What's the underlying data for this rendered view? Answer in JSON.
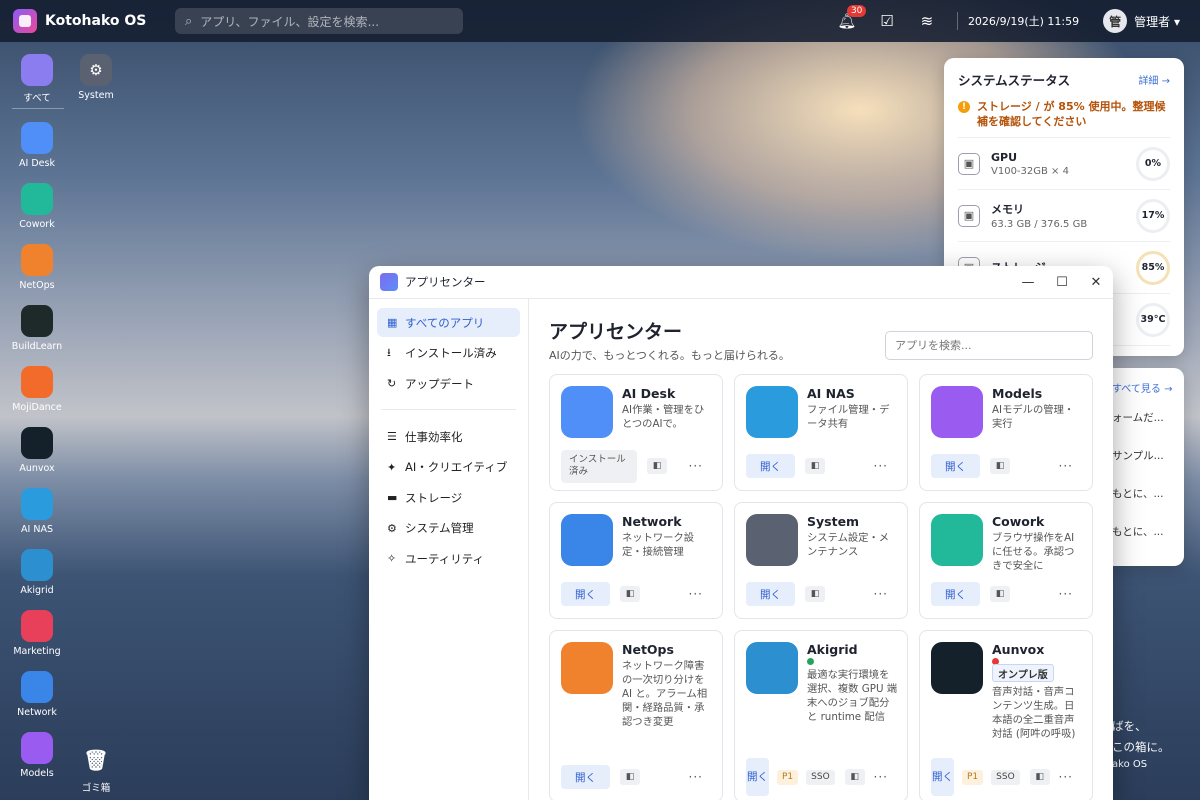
{
  "topbar": {
    "brand": "Kotohako OS",
    "search_placeholder": "アプリ、ファイル、設定を検索...",
    "notification_count": "30",
    "datetime": "2026/9/19(土) 11:59",
    "user_initial": "管",
    "user_name": "管理者"
  },
  "dock": [
    {
      "label": "すべて",
      "color": "#8b7cf0",
      "icon": "grid-icon"
    },
    {
      "label": "AI Desk",
      "color": "#4f8ff7",
      "icon": "chat-sparkle-icon"
    },
    {
      "label": "Cowork",
      "color": "#22b89a",
      "icon": "browser-cursor-icon"
    },
    {
      "label": "NetOps",
      "color": "#f0822e",
      "icon": "network-nodes-icon"
    },
    {
      "label": "BuildLearn",
      "color": "#1e2a2a",
      "icon": "terminal-chat-icon"
    },
    {
      "label": "MojiDance",
      "color": "#f26b2a",
      "icon": "dance-icon"
    },
    {
      "label": "Aunvox",
      "color": "#14202a",
      "icon": "wave-icon"
    },
    {
      "label": "AI NAS",
      "color": "#2a9bdc",
      "icon": "server-icon"
    },
    {
      "label": "Akigrid",
      "color": "#2b8fd0",
      "icon": "grid-chip-icon"
    },
    {
      "label": "Marketing",
      "color": "#e8405b",
      "icon": "megaphone-icon"
    },
    {
      "label": "Network",
      "color": "#3a86e8",
      "icon": "wifi-icon"
    },
    {
      "label": "Models",
      "color": "#9a5cf0",
      "icon": "chip-icon"
    }
  ],
  "desktop": {
    "system_label": "System",
    "trash_label": "ゴミ箱"
  },
  "status_panel": {
    "title": "システムステータス",
    "detail_link": "詳細 →",
    "warning": "ストレージ / が 85% 使用中。整理候補を確認してください",
    "resources": [
      {
        "name": "GPU",
        "sub": "V100-32GB × 4",
        "value": "0%",
        "icon": "cpu-icon"
      },
      {
        "name": "メモリ",
        "sub": "63.3 GB / 376.5 GB",
        "value": "17%",
        "icon": "memory-icon"
      },
      {
        "name": "ストレージ",
        "sub": "",
        "value": "85%",
        "icon": "storage-icon"
      },
      {
        "name": "",
        "sub": "",
        "value": "39°C",
        "icon": "temperature-icon"
      }
    ]
  },
  "panel2": {
    "link": "すべて見る →",
    "items": [
      "ォームだ...",
      "サンプル...",
      "もとに、...",
      "もとに、..."
    ]
  },
  "wallpaper_text": [
    "ばを、",
    "この箱に。",
    "ako OS"
  ],
  "window": {
    "title": "アプリセンター",
    "controls": {
      "minimize": "—",
      "maximize": "☐",
      "close": "✕"
    },
    "sidebar": {
      "primary": [
        {
          "label": "すべてのアプリ",
          "icon": "▦",
          "active": true
        },
        {
          "label": "インストール済み",
          "icon": "⭳",
          "active": false
        },
        {
          "label": "アップデート",
          "icon": "↻",
          "active": false
        }
      ],
      "categories": [
        {
          "label": "仕事効率化",
          "icon": "☰"
        },
        {
          "label": "AI・クリエイティブ",
          "icon": "✦"
        },
        {
          "label": "ストレージ",
          "icon": "▬"
        },
        {
          "label": "システム管理",
          "icon": "⚙"
        },
        {
          "label": "ユーティリティ",
          "icon": "✧"
        }
      ]
    },
    "main": {
      "title": "アプリセンター",
      "subtitle": "AIの力で、もっとつくれる。もっと届けられる。",
      "search_placeholder": "アプリを検索..."
    },
    "apps": [
      {
        "name": "AI Desk",
        "desc": "AI作業・管理をひとつのAIで。",
        "action": "インストール済み",
        "installed": true,
        "color": "#4f8ff7"
      },
      {
        "name": "AI NAS",
        "desc": "ファイル管理・データ共有",
        "action": "開く",
        "color": "#2a9bdc"
      },
      {
        "name": "Models",
        "desc": "AIモデルの管理・実行",
        "action": "開く",
        "color": "#9a5cf0"
      },
      {
        "name": "Network",
        "desc": "ネットワーク設定・接続管理",
        "action": "開く",
        "color": "#3a86e8"
      },
      {
        "name": "System",
        "desc": "システム設定・メンテナンス",
        "action": "開く",
        "color": "#5a6170"
      },
      {
        "name": "Cowork",
        "desc": "ブラウザ操作をAIに任せる。承認つきで安全に",
        "action": "開く",
        "color": "#22b89a"
      },
      {
        "name": "NetOps",
        "desc": "ネットワーク障害の一次切り分けをAI と。アラーム相関・経路品質・承認つき変更",
        "action": "開く",
        "color": "#f0822e"
      },
      {
        "name": "Akigrid",
        "desc": "最適な実行環境を選択、複数 GPU 端末へのジョブ配分と runtime 配信",
        "action": "開く",
        "tags": [
          "P1",
          "SSO"
        ],
        "dot": "#22a55b",
        "color": "#2b8fd0"
      },
      {
        "name": "Aunvox",
        "desc": "音声対話・音声コンテンツ生成。日本語の全二重音声対話 (阿吽の呼吸)",
        "action": "開く",
        "tags": [
          "P1",
          "SSO"
        ],
        "dot": "#e53935",
        "badge": "オンプレ版",
        "color": "#14202a"
      }
    ],
    "square_button": "◧",
    "more_button": "···"
  }
}
